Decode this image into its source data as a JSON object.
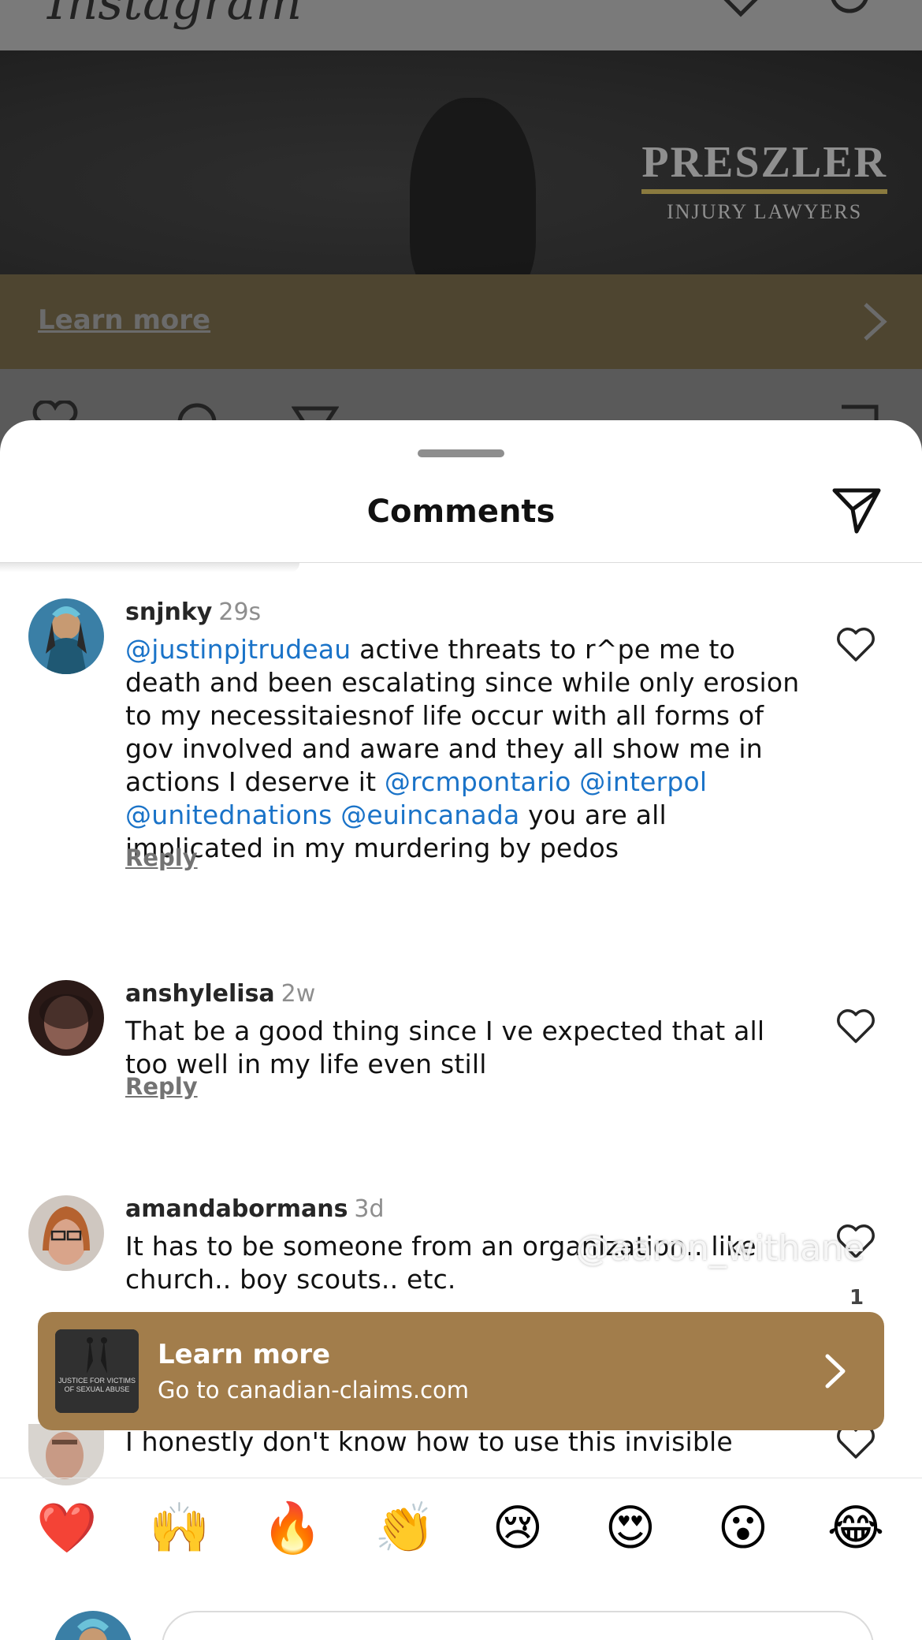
{
  "background_post": {
    "app_logo": "Instagram",
    "brand_name": "PRESZLER",
    "brand_sub": "INJURY LAWYERS",
    "cta_label": "Learn more"
  },
  "sheet": {
    "title": "Comments"
  },
  "comments": [
    {
      "username": "snjnky",
      "time": "29s",
      "segments": [
        {
          "text": "@justinpjtrudeau",
          "mention": true
        },
        {
          "text": " active threats to r^pe me to death and been escalating since while only erosion to my necessitaiesnof life occur with all forms of gov involved and aware and they all show me in actions I deserve it ",
          "mention": false
        },
        {
          "text": "@rcmpontario",
          "mention": true
        },
        {
          "text": " ",
          "mention": false
        },
        {
          "text": "@interpol",
          "mention": true
        },
        {
          "text": " ",
          "mention": false
        },
        {
          "text": "@unitednations",
          "mention": true
        },
        {
          "text": " ",
          "mention": false
        },
        {
          "text": "@euincanada",
          "mention": true
        },
        {
          "text": " you are all implicated in my murdering by pedos",
          "mention": false
        }
      ],
      "reply_label": "Reply"
    },
    {
      "username": "anshylelisa",
      "time": "2w",
      "text": "That be a good thing since I ve expected that all too well in my life even still",
      "reply_label": "Reply"
    },
    {
      "username": "amandabormans",
      "time": "3d",
      "text": "It has to be someone from an organization.. like church.. boy scouts.. etc.",
      "like_count": "1"
    },
    {
      "text": "I honestly don't know how to use this invisible"
    }
  ],
  "watermark": "@aaron_withane",
  "ad": {
    "title": "Learn more",
    "subtitle": "Go to canadian-claims.com",
    "thumb_text": "JUSTICE FOR VICTIMS OF SEXUAL ABUSE"
  },
  "reactions": [
    "❤️",
    "🙌",
    "🔥",
    "👏",
    "😢",
    "😍",
    "😮",
    "😂"
  ],
  "colors": {
    "mention": "#1a73c8",
    "ad_background": "#a27d4b",
    "overlay": "#5a5a5a"
  }
}
